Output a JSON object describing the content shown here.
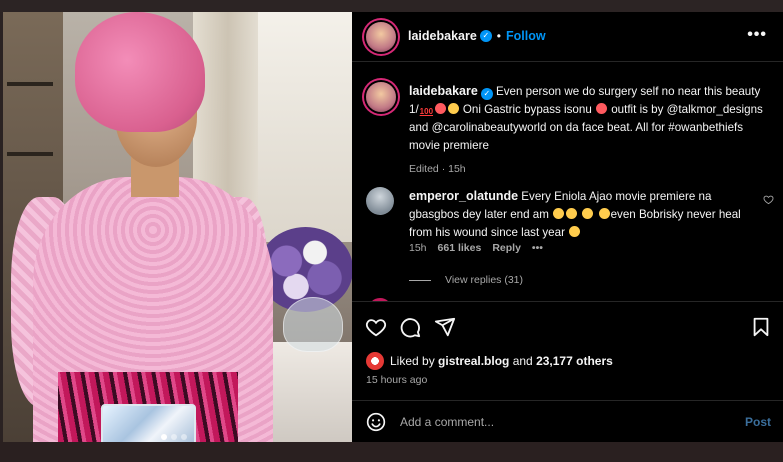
{
  "post": {
    "username": "laidebakare",
    "follow_label": "Follow",
    "more_label": "•••"
  },
  "caption": {
    "username": "laidebakare",
    "text_1": " Even person we do surgery self no near this beauty 1/",
    "text_2": " Oni Gastric bypass isonu ",
    "text_3": " outfit is by @talkmor_designs and @carolinabeautyworld on da face beat. All for #owanbethiefs movie premiere",
    "hundred_glyph": "100",
    "meta": "Edited · 15h"
  },
  "comment": {
    "username": "emperor_olatunde",
    "text_1": " Every Eniola Ajao movie premiere na gbasgbos dey later end am",
    "text_2": "even Bobrisky never heal from his wound since last year",
    "time": "15h",
    "likes": "661 likes",
    "reply": "Reply",
    "more": "•••",
    "view_replies": "View replies (31)"
  },
  "likes": {
    "prefix": "Liked by ",
    "first_user": "gistreal.blog",
    "joiner": " and ",
    "others": "23,177 others"
  },
  "timestamp": "15 hours ago",
  "add_comment": {
    "placeholder": "Add a comment...",
    "post_label": "Post"
  },
  "colors": {
    "accent": "#0095f6",
    "background": "#000000",
    "muted_text": "#a8a8a8"
  },
  "icons": [
    "heart-icon",
    "comment-icon",
    "share-icon",
    "bookmark-icon",
    "smiley-icon",
    "verified-icon",
    "more-icon"
  ]
}
